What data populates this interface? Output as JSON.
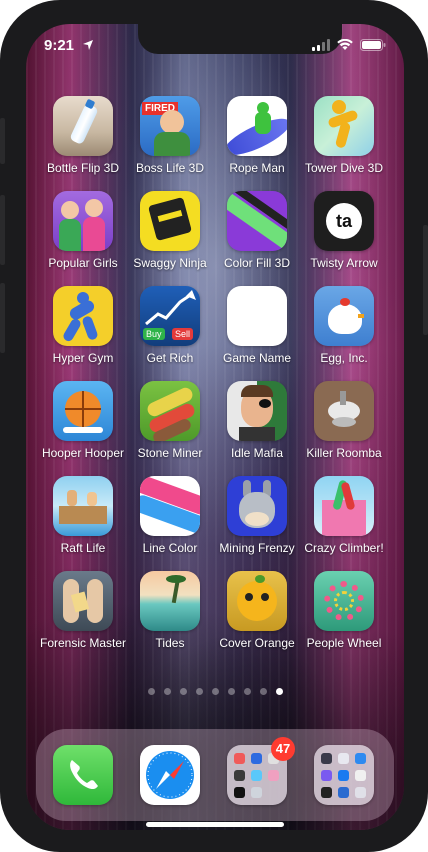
{
  "status": {
    "time": "9:21"
  },
  "apps": [
    {
      "label": "Bottle Flip 3D"
    },
    {
      "label": "Boss Life 3D"
    },
    {
      "label": "Rope Man"
    },
    {
      "label": "Tower Dive 3D"
    },
    {
      "label": "Popular Girls"
    },
    {
      "label": "Swaggy Ninja"
    },
    {
      "label": "Color Fill 3D"
    },
    {
      "label": "Twisty Arrow"
    },
    {
      "label": "Hyper Gym"
    },
    {
      "label": "Get Rich"
    },
    {
      "label": "Game Name"
    },
    {
      "label": "Egg, Inc."
    },
    {
      "label": "Hooper Hooper"
    },
    {
      "label": "Stone Miner"
    },
    {
      "label": "Idle Mafia"
    },
    {
      "label": "Killer Roomba"
    },
    {
      "label": "Raft Life"
    },
    {
      "label": "Line Color"
    },
    {
      "label": "Mining Frenzy"
    },
    {
      "label": "Crazy Climber!"
    },
    {
      "label": "Forensic Master"
    },
    {
      "label": "Tides"
    },
    {
      "label": "Cover Orange"
    },
    {
      "label": "People Wheel"
    }
  ],
  "icon_text": {
    "boss_fired": "FIRED",
    "buy": "Buy",
    "sell": "Sell",
    "twisty": "ta"
  },
  "page_dots": {
    "count": 9,
    "active_index": 8
  },
  "dock": {
    "folder_badge": "47"
  }
}
